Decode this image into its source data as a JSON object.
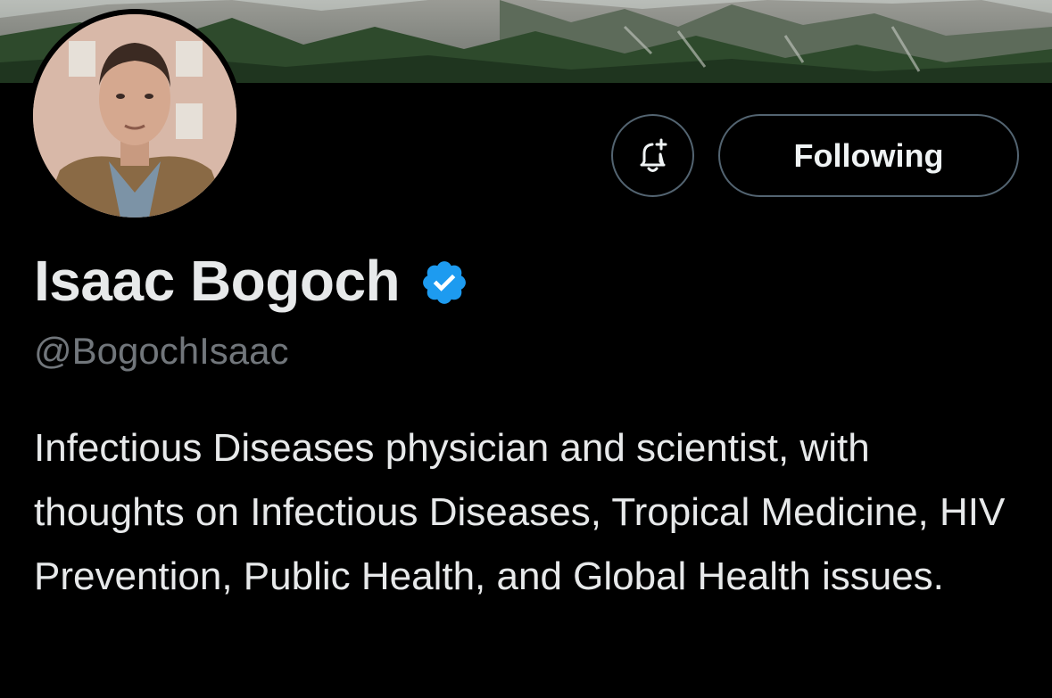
{
  "profile": {
    "display_name": "Isaac Bogoch",
    "handle": "@BogochIsaac",
    "bio": "Infectious Diseases physician and scientist, with thoughts on Infectious Diseases, Tropical Medicine, HIV Prevention, Public Health, and Global Health issues.",
    "verified": true
  },
  "actions": {
    "follow_label": "Following",
    "notify_icon": "bell-plus-icon"
  },
  "colors": {
    "background": "#000000",
    "text_primary": "#e7e9ea",
    "text_secondary": "#71767b",
    "button_border": "#536471",
    "verified_blue": "#1d9bf0"
  }
}
